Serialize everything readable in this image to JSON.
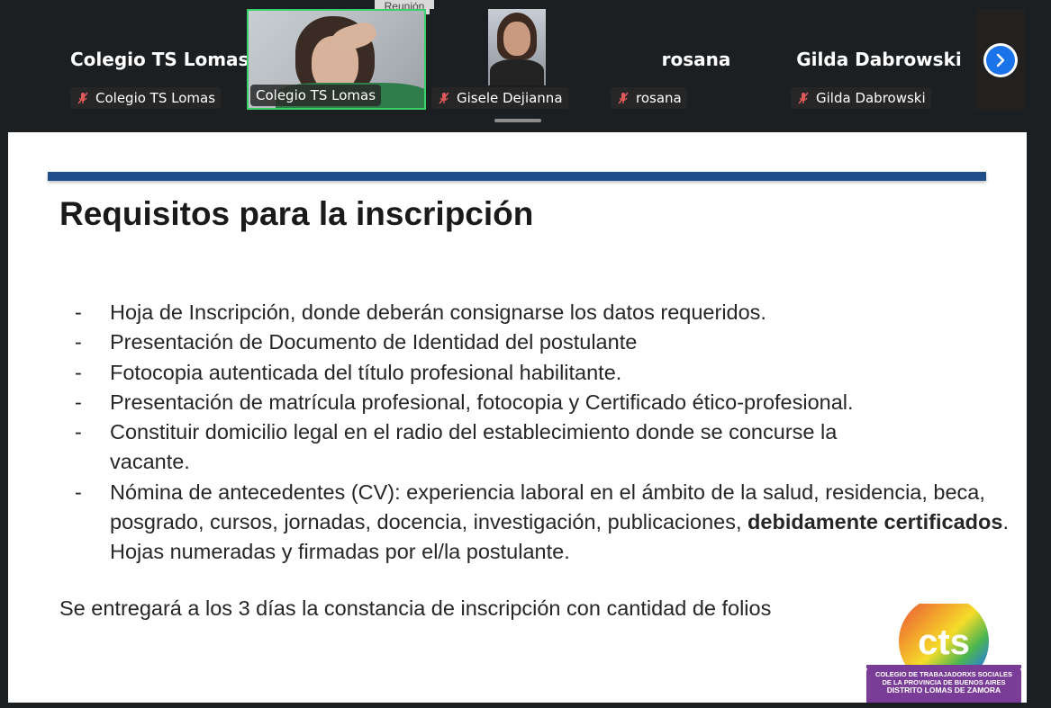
{
  "meeting": {
    "tooltip": "Reunión",
    "participants": [
      {
        "name": "Colegio TS Lomas",
        "display": "Colegio TS Lomas",
        "muted": true,
        "video": false
      },
      {
        "name": "Colegio TS Lomas",
        "display": "",
        "muted": false,
        "video": true
      },
      {
        "name": "Gisele Dejianna",
        "display": "",
        "muted": true,
        "video": false,
        "photo": true
      },
      {
        "name": "rosana",
        "display": "rosana",
        "muted": true,
        "video": false
      },
      {
        "name": "Gilda Dabrowski",
        "display": "Gilda Dabrowski",
        "muted": true,
        "video": false
      }
    ],
    "colors": {
      "active_speaker": "#3ad06b",
      "next_button": "#1a73e8",
      "mute_icon": "#e05a5a"
    }
  },
  "slide": {
    "title": "Requisitos para la inscripción",
    "bullet": "-",
    "items": [
      "Hoja de Inscripción, donde deberán consignarse los datos requeridos.",
      "Presentación de Documento de Identidad del postulante",
      "Fotocopia autenticada del título profesional habilitante.",
      "Presentación de matrícula profesional, fotocopia  y Certificado ético-profesional.",
      "Constituir domicilio legal en el radio del establecimiento donde se concurse la vacante."
    ],
    "last_item": {
      "text": "Nómina de antecedentes (CV): experiencia laboral en el ámbito de la salud, residencia, beca, posgrado, cursos, jornadas, docencia, investigación, publicaciones,",
      "bold": "debidamente certificados",
      "tail": ". Hojas numeradas y firmadas por el/la postulante."
    },
    "footer": "Se entregará a los 3 días la constancia de inscripción con cantidad de folios",
    "rule_color": "#1f4e8a",
    "logo": {
      "mark": "cts",
      "line1": "COLEGIO DE TRABAJADORXS SOCIALES",
      "line2": "DE LA PROVINCIA DE BUENOS AIRES",
      "line3": "DISTRITO LOMAS DE ZAMORA"
    }
  }
}
